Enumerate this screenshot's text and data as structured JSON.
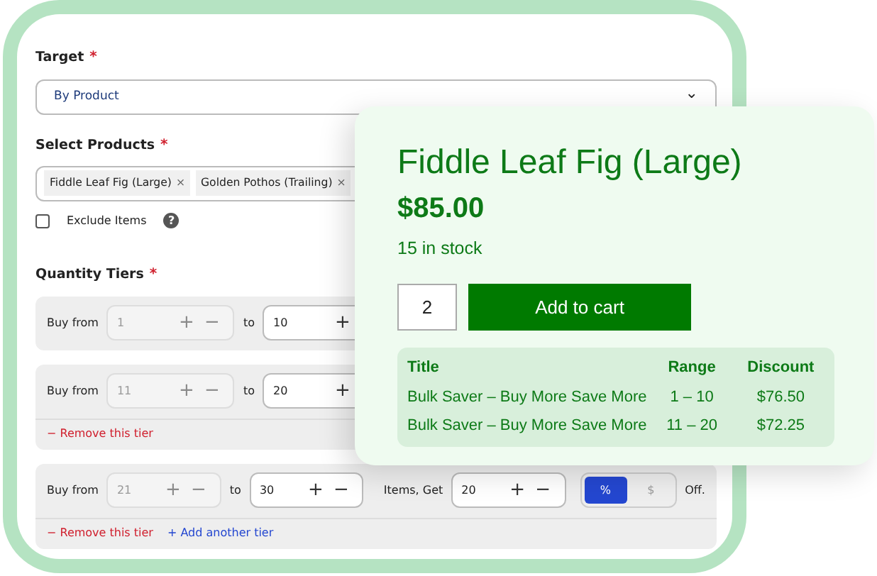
{
  "form": {
    "target": {
      "label": "Target",
      "required_mark": "*",
      "value": "By Product",
      "caret": "⌄"
    },
    "products": {
      "label": "Select Products",
      "required_mark": "*",
      "tags": [
        {
          "label": "Fiddle Leaf Fig (Large)",
          "remove": "×"
        },
        {
          "label": "Golden Pothos (Trailing)",
          "remove": "×"
        }
      ]
    },
    "exclude": {
      "label": "Exclude Items",
      "checked": false,
      "help": "?"
    },
    "tiers_label": "Quantity Tiers",
    "tiers_required_mark": "*",
    "tiers": [
      {
        "from_label": "Buy from",
        "from": "1",
        "to_label": "to",
        "to": "10",
        "plus": "+",
        "minus": "−"
      },
      {
        "from_label": "Buy from",
        "from": "11",
        "to_label": "to",
        "to": "20",
        "plus": "+",
        "minus": "−",
        "remove": "− Remove this tier"
      },
      {
        "from_label": "Buy from",
        "from": "21",
        "to_label": "to",
        "to": "30",
        "plus": "+",
        "minus": "−",
        "get_label": "Items, Get",
        "get": "20",
        "units": [
          {
            "label": "%",
            "selected": true
          },
          {
            "label": "$",
            "selected": false
          }
        ],
        "off_label": "Off.",
        "remove": "− Remove this tier",
        "add": "+ Add another tier"
      }
    ]
  },
  "product_card": {
    "title": "Fiddle Leaf Fig (Large)",
    "price": "$85.00",
    "stock": "15 in stock",
    "quantity": "2",
    "button": "Add to cart",
    "table": {
      "columns": [
        "Title",
        "Range",
        "Discount"
      ],
      "rows": [
        [
          "Bulk Saver – Buy More Save More",
          "1 – 10",
          "$76.50"
        ],
        [
          "Bulk Saver – Buy More Save More",
          "11 – 20",
          "$72.25"
        ]
      ]
    }
  }
}
